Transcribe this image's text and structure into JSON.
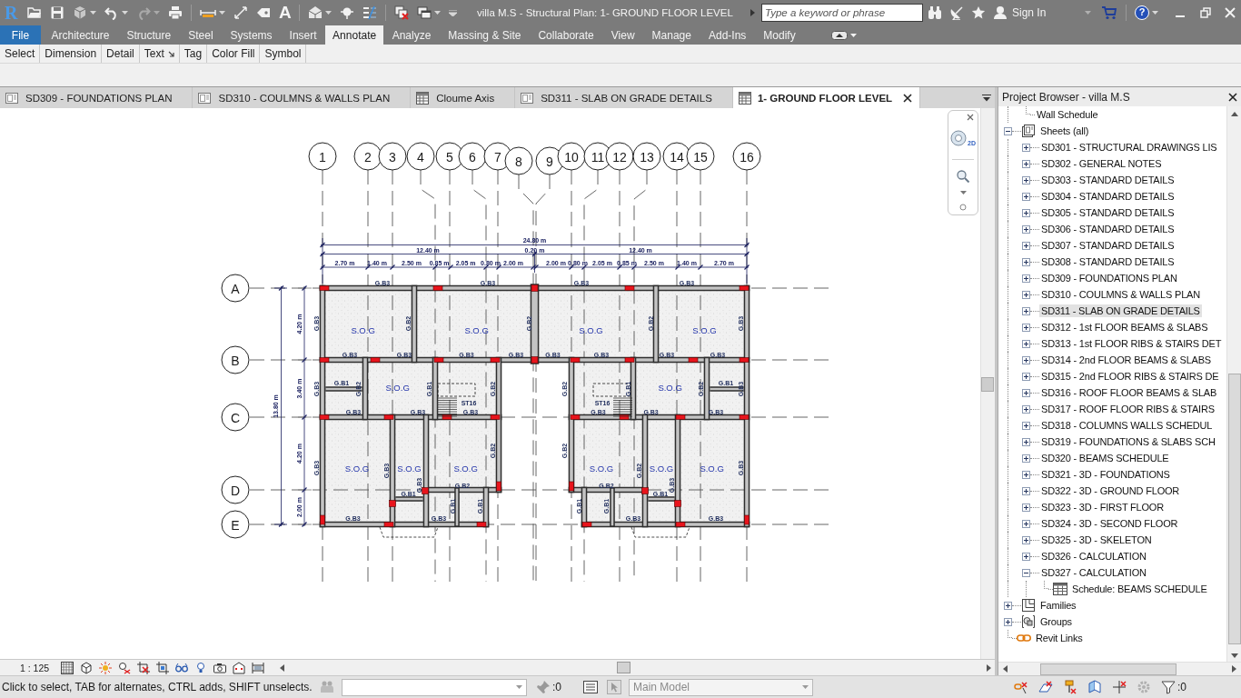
{
  "title_bar": {
    "logo": "R",
    "text_tool": "A",
    "title": "villa M.S - Structural Plan: 1- GROUND FLOOR LEVEL",
    "search": {
      "placeholder": "Type a keyword or phrase"
    },
    "sign_in": "Sign In",
    "help": "?"
  },
  "ribbon": {
    "tabs": [
      {
        "label": "File",
        "kind": "file",
        "selected": false
      },
      {
        "label": "Architecture",
        "kind": "tab",
        "selected": false
      },
      {
        "label": "Structure",
        "kind": "tab",
        "selected": false
      },
      {
        "label": "Steel",
        "kind": "tab",
        "selected": false
      },
      {
        "label": "Systems",
        "kind": "tab",
        "selected": false
      },
      {
        "label": "Insert",
        "kind": "tab",
        "selected": false
      },
      {
        "label": "Annotate",
        "kind": "tab",
        "selected": true
      },
      {
        "label": "Analyze",
        "kind": "tab",
        "selected": false
      },
      {
        "label": "Massing & Site",
        "kind": "tab",
        "selected": false
      },
      {
        "label": "Collaborate",
        "kind": "tab",
        "selected": false
      },
      {
        "label": "View",
        "kind": "tab",
        "selected": false
      },
      {
        "label": "Manage",
        "kind": "tab",
        "selected": false
      },
      {
        "label": "Add-Ins",
        "kind": "tab",
        "selected": false
      },
      {
        "label": "Modify",
        "kind": "tab",
        "selected": false
      }
    ],
    "panels": [
      {
        "label": "Select",
        "launcher": false
      },
      {
        "label": "Dimension",
        "launcher": false
      },
      {
        "label": "Detail",
        "launcher": false
      },
      {
        "label": "Text",
        "launcher": true
      },
      {
        "label": "Tag",
        "launcher": false
      },
      {
        "label": "Color Fill",
        "launcher": false
      },
      {
        "label": "Symbol",
        "launcher": false
      }
    ]
  },
  "view_tabs": [
    {
      "label": "SD309 - FOUNDATIONS PLAN",
      "kind": "sheet",
      "selected": false
    },
    {
      "label": "SD310 - COULMNS & WALLS PLAN",
      "kind": "sheet",
      "selected": false
    },
    {
      "label": "Cloume Axis",
      "kind": "view",
      "selected": false
    },
    {
      "label": "SD311 - SLAB ON GRADE DETAILS",
      "kind": "sheet",
      "selected": false
    },
    {
      "label": "1- GROUND FLOOR LEVEL",
      "kind": "view",
      "selected": true
    }
  ],
  "drawing": {
    "grid_columns": [
      "1",
      "2",
      "3",
      "4",
      "5",
      "6",
      "7",
      "8",
      "9",
      "10",
      "11",
      "12",
      "13",
      "14",
      "15",
      "16"
    ],
    "grid_rows": [
      "A",
      "B",
      "C",
      "D",
      "E"
    ],
    "overall_dimension": "24.80 m",
    "half_dimensions": [
      "12.40 m",
      "12.40 m"
    ],
    "chain_dimensions": [
      "2.70 m",
      "1.40 m",
      "2.50 m",
      "0.85 m",
      "2.05 m",
      "0.80 m",
      "2.00 m",
      "0.20 m",
      "2.00 m",
      "0.80 m",
      "2.05 m",
      "0.85 m",
      "2.50 m",
      "1.40 m",
      "2.70 m"
    ],
    "row_dimensions": [
      "4.20 m",
      "3.40 m",
      "4.20 m",
      "2.00 m"
    ],
    "rows_total_dimension": "13.80 m",
    "slab_labels": [
      "S.O.G",
      "S.O.G",
      "S.O.G",
      "S.O.G",
      "S.O.G",
      "S.O.G",
      "S.O.G",
      "S.O.G",
      "S.O.G",
      "S.O.G",
      "S.O.G",
      "S.O.G"
    ],
    "beam_labels": [
      "G.B3",
      "G.B3",
      "G.B3",
      "G.B3",
      "G.B3",
      "G.B2",
      "G.B2",
      "G.B2",
      "G.B3",
      "G.B3",
      "G.B3",
      "G.B3",
      "G.B3",
      "G.B3",
      "G.B3",
      "G.B3",
      "G.B3",
      "G.B1",
      "G.B1",
      "G.B3",
      "G.B2",
      "G.B1",
      "G.B2",
      "G.B2",
      "G.B1",
      "G.B2",
      "G.B3",
      "G.B3",
      "G.B3",
      "G.B3",
      "G.B3",
      "G.B3",
      "G.B3",
      "G.B2",
      "G.B2",
      "G.B3",
      "G.B3",
      "G.B3",
      "G.B2",
      "G.B3",
      "G.B3",
      "G.B2",
      "G.B2",
      "G.B1",
      "G.B1",
      "G.B1",
      "G.B1",
      "G.B1",
      "G.B1",
      "G.B3",
      "G.B3",
      "G.B3",
      "G.B3"
    ],
    "stair_labels": [
      "ST16",
      "ST16"
    ]
  },
  "nav_bar": {
    "wheel_label": "2D"
  },
  "view_control_bar": {
    "scale": "1 : 125"
  },
  "project_browser": {
    "title": "Project Browser - villa M.S",
    "tree": [
      {
        "kind": "offscreen-parent",
        "children": [
          {
            "label": "Wall Schedule",
            "selected": false
          }
        ]
      },
      {
        "label": "Sheets (all)",
        "kind": "sheets",
        "expanded": true,
        "selected": false,
        "children": [
          {
            "label": "SD301 - STRUCTURAL DRAWINGS LIS",
            "expanded": false,
            "selected": false
          },
          {
            "label": "SD302 - GENERAL NOTES",
            "expanded": false,
            "selected": false
          },
          {
            "label": "SD303 - STANDARD DETAILS",
            "expanded": false,
            "selected": false
          },
          {
            "label": "SD304 - STANDARD DETAILS",
            "expanded": false,
            "selected": false
          },
          {
            "label": "SD305 - STANDARD DETAILS",
            "expanded": false,
            "selected": false
          },
          {
            "label": "SD306 - STANDARD DETAILS",
            "expanded": false,
            "selected": false
          },
          {
            "label": "SD307 - STANDARD DETAILS",
            "expanded": false,
            "selected": false
          },
          {
            "label": "SD308 - STANDARD DETAILS",
            "expanded": false,
            "selected": false
          },
          {
            "label": "SD309 - FOUNDATIONS PLAN",
            "expanded": false,
            "selected": false
          },
          {
            "label": "SD310 - COULMNS & WALLS PLAN",
            "expanded": false,
            "selected": false
          },
          {
            "label": "SD311 - SLAB ON GRADE DETAILS",
            "expanded": false,
            "selected": true
          },
          {
            "label": "SD312 - 1st FLOOR BEAMS & SLABS",
            "expanded": false,
            "selected": false
          },
          {
            "label": "SD313 - 1st FLOOR RIBS & STAIRS DET",
            "expanded": false,
            "selected": false
          },
          {
            "label": "SD314 - 2nd FLOOR BEAMS & SLABS",
            "expanded": false,
            "selected": false
          },
          {
            "label": "SD315 - 2nd FLOOR RIBS & STAIRS DE",
            "expanded": false,
            "selected": false
          },
          {
            "label": "SD316 - ROOF FLOOR BEAMS & SLAB",
            "expanded": false,
            "selected": false
          },
          {
            "label": "SD317 - ROOF FLOOR RIBS & STAIRS",
            "expanded": false,
            "selected": false
          },
          {
            "label": "SD318 - COLUMNS WALLS SCHEDUL",
            "expanded": false,
            "selected": false
          },
          {
            "label": "SD319 - FOUNDATIONS & SLABS SCH",
            "expanded": false,
            "selected": false
          },
          {
            "label": "SD320 - BEAMS SCHEDULE",
            "expanded": false,
            "selected": false
          },
          {
            "label": "SD321 - 3D - FOUNDATIONS",
            "expanded": false,
            "selected": false
          },
          {
            "label": "SD322 - 3D - GROUND FLOOR",
            "expanded": false,
            "selected": false
          },
          {
            "label": "SD323 - 3D - FIRST FLOOR",
            "expanded": false,
            "selected": false
          },
          {
            "label": "SD324 - 3D - SECOND FLOOR",
            "expanded": false,
            "selected": false
          },
          {
            "label": "SD325 - 3D - SKELETON",
            "expanded": false,
            "selected": false
          },
          {
            "label": "SD326 - CALCULATION",
            "expanded": false,
            "selected": false
          },
          {
            "label": "SD327 - CALCULATION",
            "expanded": true,
            "selected": false,
            "children": [
              {
                "label": "Schedule: BEAMS SCHEDULE",
                "kind": "schedule",
                "selected": false
              }
            ]
          }
        ]
      },
      {
        "label": "Families",
        "kind": "families",
        "expanded": false,
        "selected": false
      },
      {
        "label": "Groups",
        "kind": "groups",
        "expanded": false,
        "selected": false
      },
      {
        "label": "Revit Links",
        "kind": "links",
        "selected": false
      }
    ]
  },
  "status_bar": {
    "message": "Click to select, TAB for alternates, CTRL adds, SHIFT unselects.",
    "editable_counter": ":0",
    "design_option": {
      "value": "Main Model",
      "disabled": true
    },
    "filter_counter": ":0"
  }
}
